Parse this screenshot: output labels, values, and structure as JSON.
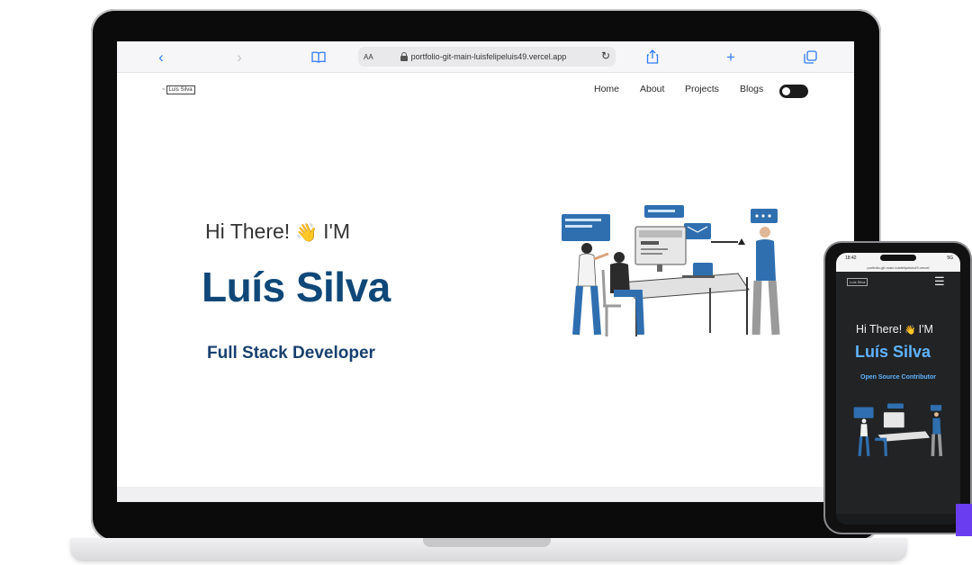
{
  "browser": {
    "url": "portfolio-git-main-luisfelipeluis49.vercel.app",
    "text_size_label": "AA"
  },
  "site": {
    "logo_prefix": "~",
    "logo_text": "Luís Silva",
    "nav": [
      "Home",
      "About",
      "Projects",
      "Blogs"
    ],
    "greeting_hi": "Hi There!",
    "greeting_im": "I'M",
    "name": "Luís Silva",
    "role": "Full Stack Developer"
  },
  "phone": {
    "time": "18:42",
    "signal": "5G",
    "url": "portfolio-git-main-luisfelipeluis49.vercel",
    "logo_text": "Luís Silva",
    "greeting_hi": "Hi There!",
    "greeting_im": "I'M",
    "name": "Luís Silva",
    "role": "Open Source Contributor"
  },
  "colors": {
    "name_blue": "#0f4878",
    "role_blue": "#17406f",
    "phone_accent": "#5fb3ff",
    "phone_bg": "#212325",
    "safari_blue": "#2f7bf5"
  }
}
